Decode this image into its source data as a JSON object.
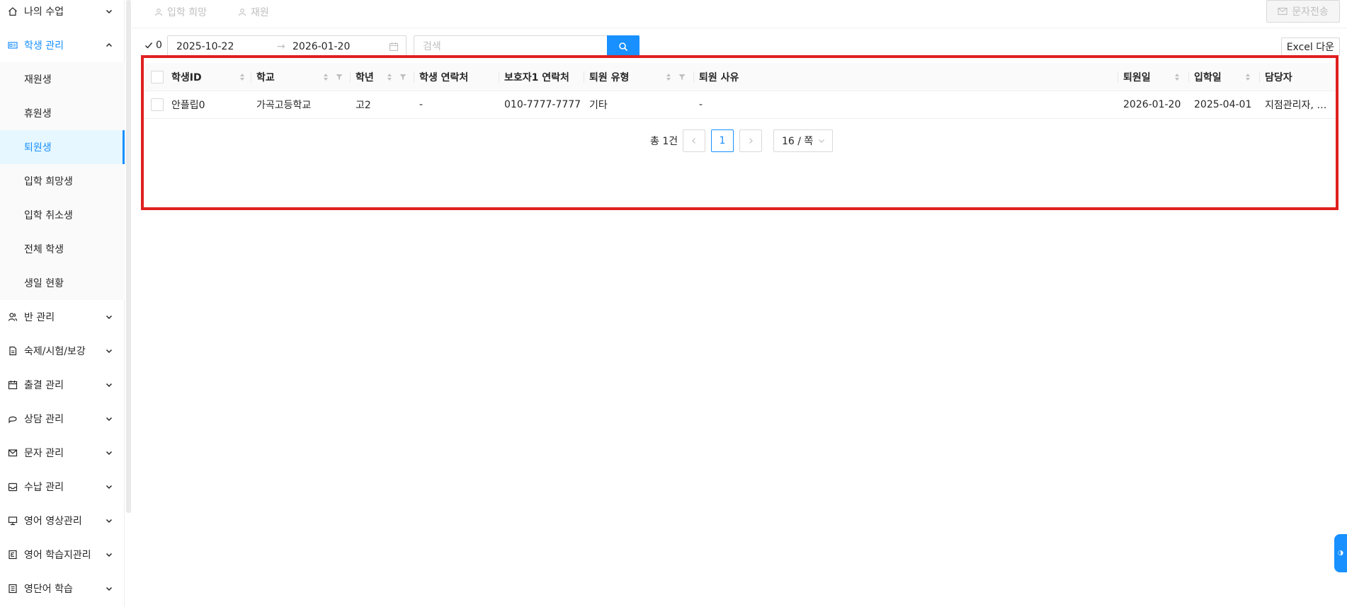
{
  "sidebar": {
    "items": [
      {
        "label": "나의 수업",
        "icon": "home-icon"
      },
      {
        "label": "학생 관리",
        "icon": "id-card-icon",
        "expanded": true
      },
      {
        "label": "반 관리",
        "icon": "users-icon"
      },
      {
        "label": "숙제/시험/보강",
        "icon": "document-icon"
      },
      {
        "label": "출결 관리",
        "icon": "calendar-icon"
      },
      {
        "label": "상담 관리",
        "icon": "chat-icon"
      },
      {
        "label": "문자 관리",
        "icon": "mail-icon"
      },
      {
        "label": "수납 관리",
        "icon": "inbox-icon"
      },
      {
        "label": "영어 영상관리",
        "icon": "monitor-icon"
      },
      {
        "label": "영어 학습지관리",
        "icon": "e-book-icon"
      },
      {
        "label": "영단어 학습",
        "icon": "keyboard-icon"
      }
    ],
    "submenu": [
      {
        "label": "재원생"
      },
      {
        "label": "휴원생"
      },
      {
        "label": "퇴원생",
        "selected": true
      },
      {
        "label": "입학 희망생"
      },
      {
        "label": "입학 취소생"
      },
      {
        "label": "전체 학생"
      },
      {
        "label": "생일 현황"
      }
    ]
  },
  "toptabs": {
    "tab1": "입학 희망",
    "tab2": "재원",
    "sms_button": "문자전송"
  },
  "filter": {
    "check_count": "0",
    "date_start": "2025-10-22",
    "date_separator": "→",
    "date_end": "2026-01-20",
    "search_placeholder": "검색",
    "excel_button": "Excel 다운"
  },
  "table": {
    "columns": {
      "student_id": "학생ID",
      "school": "학교",
      "grade": "학년",
      "student_contact": "학생 연락처",
      "guardian_contact": "보호자1 연락처",
      "withdraw_type": "퇴원 유형",
      "withdraw_reason": "퇴원 사유",
      "withdraw_date": "퇴원일",
      "admission_date": "입학일",
      "manager": "담당자"
    },
    "rows": [
      {
        "student_id": "안플립0",
        "school": "가곡고등학교",
        "grade": "고2",
        "student_contact": "-",
        "guardian_contact": "010-7777-7777",
        "withdraw_type": "기타",
        "withdraw_reason": "-",
        "withdraw_date": "2026-01-20",
        "admission_date": "2025-04-01",
        "manager": "지점관리자, 이…"
      }
    ]
  },
  "pagination": {
    "total": "총 1건",
    "current_page": "1",
    "page_size": "16 / 쪽"
  },
  "colors": {
    "primary": "#1890ff",
    "highlight": "#e02020"
  }
}
